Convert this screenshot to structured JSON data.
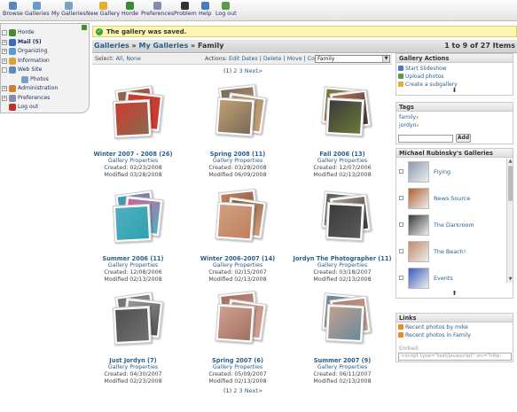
{
  "toolbar": {
    "items": [
      {
        "label": "Browse",
        "icon": "browse-icon",
        "color": "#5a86c2"
      },
      {
        "label": "Galleries",
        "icon": "galleries-icon",
        "color": "#6a9ad0"
      },
      {
        "label": "My Galleries",
        "icon": "my-galleries-icon",
        "color": "#7aa0c8"
      },
      {
        "label": "New Gallery",
        "icon": "new-gallery-icon",
        "color": "#e0b030"
      },
      {
        "label": "Horde",
        "icon": "horde-icon",
        "color": "#3a8a3a"
      },
      {
        "label": "Preferences",
        "icon": "preferences-icon",
        "color": "#8a8ab0"
      },
      {
        "label": "Problem",
        "icon": "problem-icon",
        "color": "#333333"
      },
      {
        "label": "Help",
        "icon": "help-icon",
        "color": "#4a7ac0"
      },
      {
        "label": "Log out",
        "icon": "logout-icon",
        "color": "#5a9a4a"
      }
    ]
  },
  "sidebar": {
    "items": [
      {
        "label": "Horde",
        "color": "#4a8c2a",
        "toggle": "-",
        "bold": false
      },
      {
        "label": "Mail (5)",
        "color": "#3a6ac0",
        "toggle": "+",
        "bold": true
      },
      {
        "label": "Organizing",
        "color": "#5a9ad0",
        "toggle": "+",
        "bold": false
      },
      {
        "label": "Information",
        "color": "#e0a030",
        "toggle": "+",
        "bold": false
      },
      {
        "label": "Web Site",
        "color": "#5a8ac0",
        "toggle": "-",
        "bold": false
      },
      {
        "label": "Photos",
        "color": "#7aa0c8",
        "toggle": "",
        "bold": false
      },
      {
        "label": "Administration",
        "color": "#d08030",
        "toggle": "+",
        "bold": false
      },
      {
        "label": "Preferences",
        "color": "#8a8ab0",
        "toggle": "+",
        "bold": false
      },
      {
        "label": "Log out",
        "color": "#c03030",
        "toggle": "",
        "bold": false
      }
    ]
  },
  "notice": "The gallery was saved.",
  "breadcrumb": {
    "root": "Galleries",
    "sep": "»",
    "mid": "My Galleries",
    "current": "Family"
  },
  "count": "1 to 9 of 27 Items",
  "actions": {
    "select_label": "Select:",
    "all": "All",
    "none": "None",
    "actions_label": "Actions:",
    "edit_dates": "Edit Dates",
    "delete": "Delete",
    "move": "Move",
    "copy": "Copy",
    "target": "Family",
    "sep": "|"
  },
  "pager": {
    "current": "(1)",
    "p2": "2",
    "p3": "3",
    "next": "Next>"
  },
  "galleries": [
    {
      "title": "Winter 2007 - 2008 (26)",
      "props": "Gallery Properties",
      "created": "Created: 02/23/2008",
      "modified": "Modified 03/28/2008",
      "colors": [
        "#8a6a50",
        "#c04030",
        "#d03a30"
      ]
    },
    {
      "title": "Spring 2008 (11)",
      "props": "Gallery Properties",
      "created": "Created: 03/28/2008",
      "modified": "Modified 06/09/2008",
      "colors": [
        "#7a6a5a",
        "#b09070",
        "#c0a070"
      ]
    },
    {
      "title": "Fall 2006 (13)",
      "props": "Gallery Properties",
      "created": "Created: 12/07/2006",
      "modified": "Modified 02/13/2008",
      "colors": [
        "#6a7a3a",
        "#c07050",
        "#3a3a3a"
      ]
    },
    {
      "title": "Summer 2006 (11)",
      "props": "Gallery Properties",
      "created": "Created: 12/08/2006",
      "modified": "Modified 02/13/2008",
      "colors": [
        "#30a0b0",
        "#d060a0",
        "#50b0c0"
      ]
    },
    {
      "title": "Winter 2006-2007 (14)",
      "props": "Gallery Properties",
      "created": "Created: 02/15/2007",
      "modified": "Modified 02/13/2008",
      "colors": [
        "#c08060",
        "#8a5a40",
        "#d0a080"
      ]
    },
    {
      "title": "Jordyn The Photographer (11)",
      "props": "Gallery Properties",
      "created": "Created: 03/18/2007",
      "modified": "Modified 02/13/2008",
      "colors": [
        "#5a5a5a",
        "#b0a090",
        "#3a3a3a"
      ]
    },
    {
      "title": "Just Jordyn (7)",
      "props": "Gallery Properties",
      "created": "Created: 04/30/2007",
      "modified": "Modified 02/23/2008",
      "colors": [
        "#707070",
        "#9a9a9a",
        "#505050"
      ]
    },
    {
      "title": "Spring 2007 (6)",
      "props": "Gallery Properties",
      "created": "Created: 05/09/2007",
      "modified": "Modified 02/13/2008",
      "colors": [
        "#a07060",
        "#c09080",
        "#d0a090"
      ]
    },
    {
      "title": "Summer 2007 (9)",
      "props": "Gallery Properties",
      "created": "Created: 06/11/2007",
      "modified": "Modified 02/13/2008",
      "colors": [
        "#6a8a9a",
        "#b08070",
        "#c0a090"
      ]
    }
  ],
  "gallery_actions": {
    "title": "Gallery Actions",
    "items": [
      {
        "label": "Start Slideshow",
        "color": "#4a7ac0"
      },
      {
        "label": "Upload photos",
        "color": "#5a9a4a"
      },
      {
        "label": "Create a subgallery",
        "color": "#e0b030"
      }
    ]
  },
  "tags": {
    "title": "Tags",
    "items": [
      "family",
      "jordyn"
    ],
    "remove": "x",
    "add_button": "Add"
  },
  "user_galleries": {
    "title": "Michael Rubinsky's Galleries",
    "items": [
      {
        "label": "Flying",
        "color": "#8a9ab0"
      },
      {
        "label": "News Source",
        "color": "#b06030"
      },
      {
        "label": "The Darkroom",
        "color": "#3a3a3a"
      },
      {
        "label": "The Beach!",
        "color": "#c08a6a"
      },
      {
        "label": "Events",
        "color": "#3a5ac0"
      }
    ]
  },
  "links": {
    "title": "Links",
    "rss1": "Recent photos by mike",
    "rss2": "Recent photos in Family",
    "embed_label": "Embed:",
    "embed_value": "<script type=\"text/javascript\" src=\"http:"
  }
}
